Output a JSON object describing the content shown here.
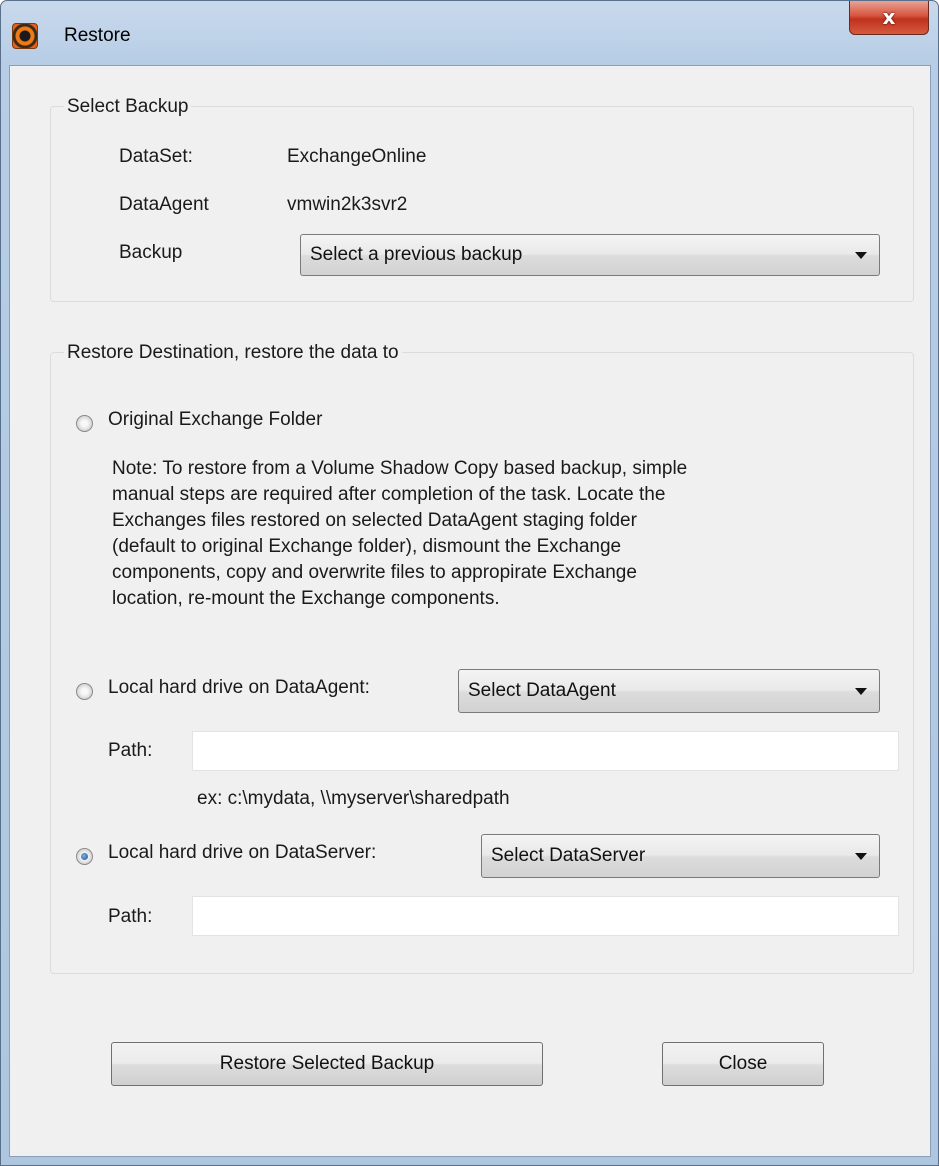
{
  "window": {
    "title": "Restore",
    "close_glyph": "x"
  },
  "select_backup": {
    "group_title": "Select Backup",
    "dataset_label": "DataSet:",
    "dataset_value": "ExchangeOnline",
    "dataagent_label": "DataAgent",
    "dataagent_value": "vmwin2k3svr2",
    "backup_label": "Backup",
    "backup_selected": "Select a previous backup"
  },
  "destination": {
    "group_title": "Restore Destination, restore the data to",
    "original_label": "Original Exchange Folder",
    "note_lines": [
      "Note: To restore from a Volume Shadow Copy based backup, simple",
      "manual steps are required after completion of the task. Locate the",
      "Exchanges files restored on selected DataAgent staging folder",
      "(default to original Exchange folder), dismount the Exchange",
      "components, copy and overwrite files to appropirate Exchange",
      "location, re-mount the Exchange components."
    ],
    "agent_label": "Local hard drive on DataAgent:",
    "agent_selected": "Select DataAgent",
    "agent_path_label": "Path:",
    "agent_path_value": "",
    "path_example": "ex: c:\\mydata, \\\\myserver\\sharedpath",
    "server_label": "Local hard drive on DataServer:",
    "server_selected": "Select DataServer",
    "server_path_label": "Path:",
    "server_path_value": "",
    "selected_option": "server"
  },
  "buttons": {
    "restore": "Restore Selected Backup",
    "close": "Close"
  }
}
